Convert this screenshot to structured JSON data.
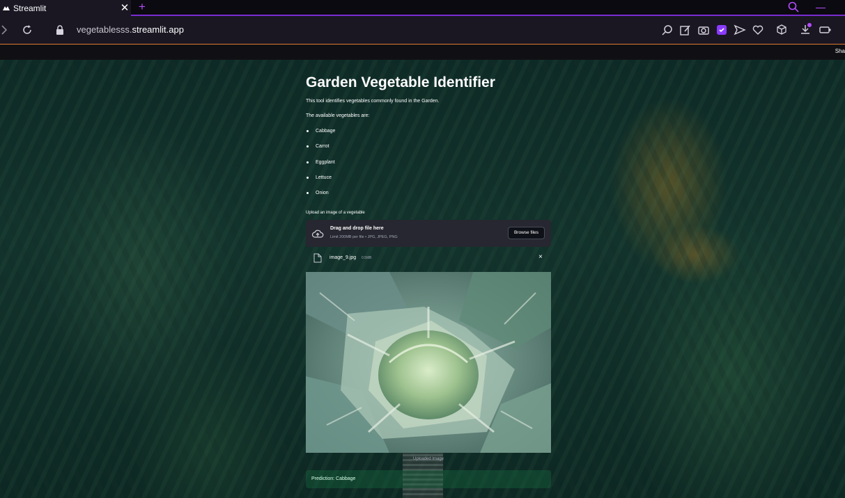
{
  "browser": {
    "tab_title": "Streamlit",
    "tab_close": "✕",
    "new_tab": "+",
    "url_prefix": "vegetablesss.",
    "url_domain": "streamlit.app",
    "bookmarks_right_text": "Sha"
  },
  "app": {
    "title": "Garden Vegetable Identifier",
    "description": "This tool identifies vegetables commonly found in the Garden.",
    "available_heading": "The available vegetables are:",
    "vegetables": [
      "Cabbage",
      "Carrot",
      "Eggplant",
      "Lettuce",
      "Onion"
    ],
    "uploader": {
      "label": "Upload an image of a vegetable",
      "drop_title": "Drag and drop file here",
      "drop_subtitle": "Limit 200MB per file • JPG, JPEG, PNG",
      "browse_label": "Browse files"
    },
    "file": {
      "name": "image_9.jpg",
      "size": "0.5MB",
      "remove": "×"
    },
    "image_caption": "Uploaded Image",
    "prediction": "Prediction: Cabbage"
  },
  "colors": {
    "accent": "#b44dff",
    "success_bg": "#177245"
  }
}
